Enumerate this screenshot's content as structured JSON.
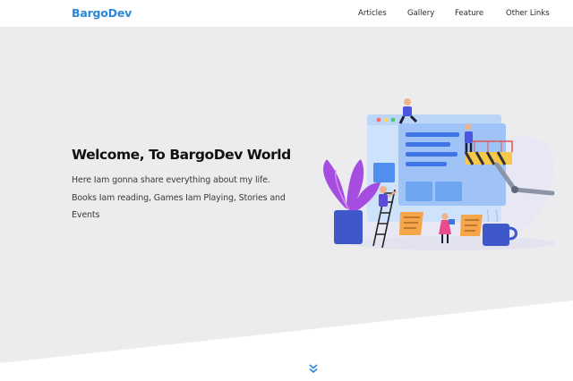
{
  "navbar": {
    "brand": "BargoDev",
    "links": [
      "Articles",
      "Gallery",
      "Feature",
      "Other Links"
    ]
  },
  "hero": {
    "title": "Welcome, To BargoDev World",
    "lines": [
      "Here Iam gonna share everything about my life.",
      "Books Iam reading, Games Iam Playing, Stories and",
      "Events"
    ]
  },
  "icons": {
    "scroll": "double-chevron-down-icon"
  },
  "colors": {
    "brand": "#2b88d8",
    "hero_bg": "#ececee",
    "accent_blue": "#3f74e6"
  }
}
